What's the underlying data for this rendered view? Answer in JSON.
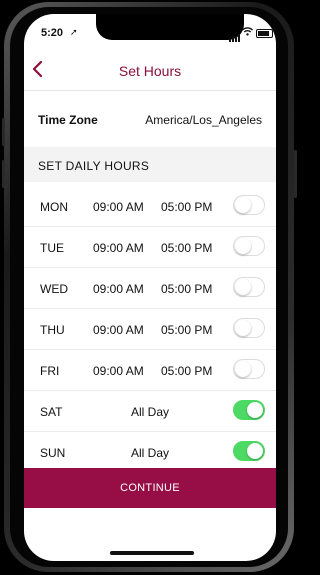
{
  "status_bar": {
    "time": "5:20",
    "location_icon": "location-arrow-icon",
    "signal_icon": "cell-signal-icon",
    "wifi_icon": "wifi-icon",
    "battery_icon": "battery-icon"
  },
  "nav": {
    "title": "Set Hours",
    "back_icon": "chevron-left-icon"
  },
  "timezone": {
    "label": "Time Zone",
    "value": "America/Los_Angeles"
  },
  "section_title": "SET DAILY HOURS",
  "days": [
    {
      "name": "MON",
      "start": "09:00 AM",
      "end": "05:00 PM",
      "enabled": false
    },
    {
      "name": "TUE",
      "start": "09:00 AM",
      "end": "05:00 PM",
      "enabled": false
    },
    {
      "name": "WED",
      "start": "09:00 AM",
      "end": "05:00 PM",
      "enabled": false
    },
    {
      "name": "THU",
      "start": "09:00 AM",
      "end": "05:00 PM",
      "enabled": false
    },
    {
      "name": "FRI",
      "start": "09:00 AM",
      "end": "05:00 PM",
      "enabled": false
    },
    {
      "name": "SAT",
      "all_day": "All Day",
      "enabled": true
    },
    {
      "name": "SUN",
      "all_day": "All Day",
      "enabled": true
    }
  ],
  "continue_label": "CONTINUE",
  "colors": {
    "brand": "#960e45",
    "title": "#8b1037",
    "toggle_on": "#4cd964"
  }
}
